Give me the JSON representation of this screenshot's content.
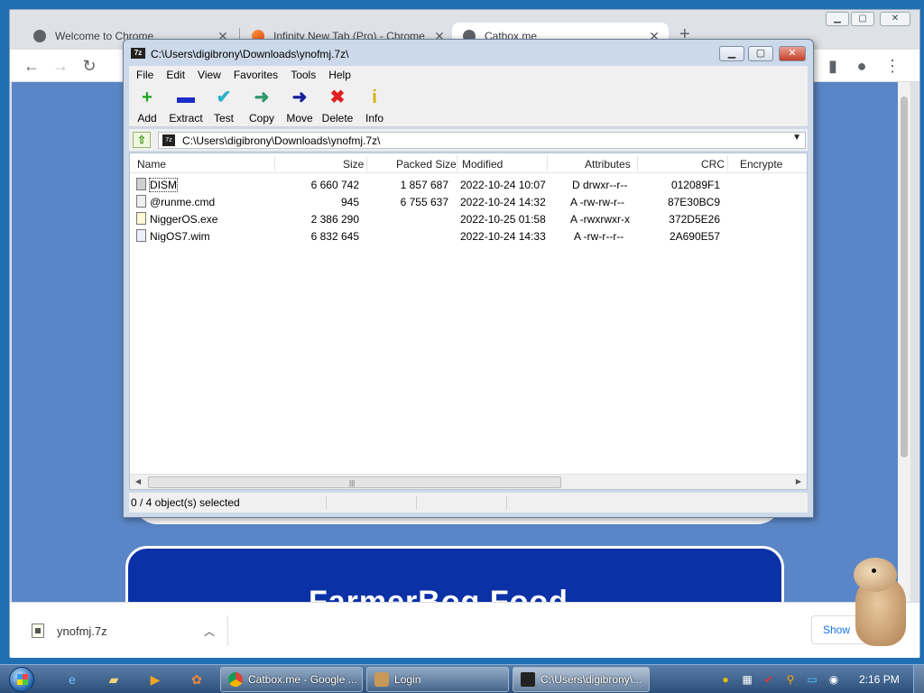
{
  "chrome": {
    "tabs": [
      {
        "title": "Welcome to Chrome"
      },
      {
        "title": "Infinity New Tab (Pro) - Chrome"
      },
      {
        "title": "Catbox.me"
      }
    ],
    "page": {
      "banner_text": "FarmerBog Food"
    },
    "download": {
      "filename": "ynofmj.7z",
      "show_all": "Show"
    }
  },
  "sevenzip": {
    "title": "C:\\Users\\digibrony\\Downloads\\ynofmj.7z\\",
    "menu": [
      "File",
      "Edit",
      "View",
      "Favorites",
      "Tools",
      "Help"
    ],
    "toolbar": [
      {
        "label": "Add",
        "icon": "+",
        "color": "#1fa51f"
      },
      {
        "label": "Extract",
        "icon": "▬",
        "color": "#1a2cc9"
      },
      {
        "label": "Test",
        "icon": "✔",
        "color": "#2bb2c9"
      },
      {
        "label": "Copy",
        "icon": "➜",
        "color": "#2e9a6c"
      },
      {
        "label": "Move",
        "icon": "➜",
        "color": "#151f9c"
      },
      {
        "label": "Delete",
        "icon": "✖",
        "color": "#e02020"
      },
      {
        "label": "Info",
        "icon": "i",
        "color": "#d4b000"
      }
    ],
    "path": "C:\\Users\\digibrony\\Downloads\\ynofmj.7z\\",
    "columns": [
      "Name",
      "Size",
      "Packed Size",
      "Modified",
      "Attributes",
      "CRC",
      "Encrypte"
    ],
    "rows": [
      {
        "name": "DISM",
        "size": "6 660 742",
        "packed": "1 857 687",
        "modified": "2022-10-24 10:07",
        "attributes": "D drwxr--r--",
        "crc": "012089F1",
        "type": "dir"
      },
      {
        "name": "@runme.cmd",
        "size": "945",
        "packed": "6 755 637",
        "modified": "2022-10-24 14:32",
        "attributes": "A -rw-rw-r--",
        "crc": "87E30BC9",
        "type": "file"
      },
      {
        "name": "NiggerOS.exe",
        "size": "2 386 290",
        "packed": "",
        "modified": "2022-10-25 01:58",
        "attributes": "A -rwxrwxr-x",
        "crc": "372D5E26",
        "type": "exe"
      },
      {
        "name": "NigOS7.wim",
        "size": "6 832 645",
        "packed": "",
        "modified": "2022-10-24 14:33",
        "attributes": "A -rw-r--r--",
        "crc": "2A690E57",
        "type": "wim"
      }
    ],
    "status": "0 / 4 object(s) selected"
  },
  "taskbar": {
    "tasks": [
      {
        "title": "Catbox.me - Google ...",
        "icon": "chrome"
      },
      {
        "title": "Login",
        "icon": "login"
      },
      {
        "title": "C:\\Users\\digibrony\\...",
        "icon": "sz"
      }
    ],
    "clock": "2:16 PM"
  }
}
